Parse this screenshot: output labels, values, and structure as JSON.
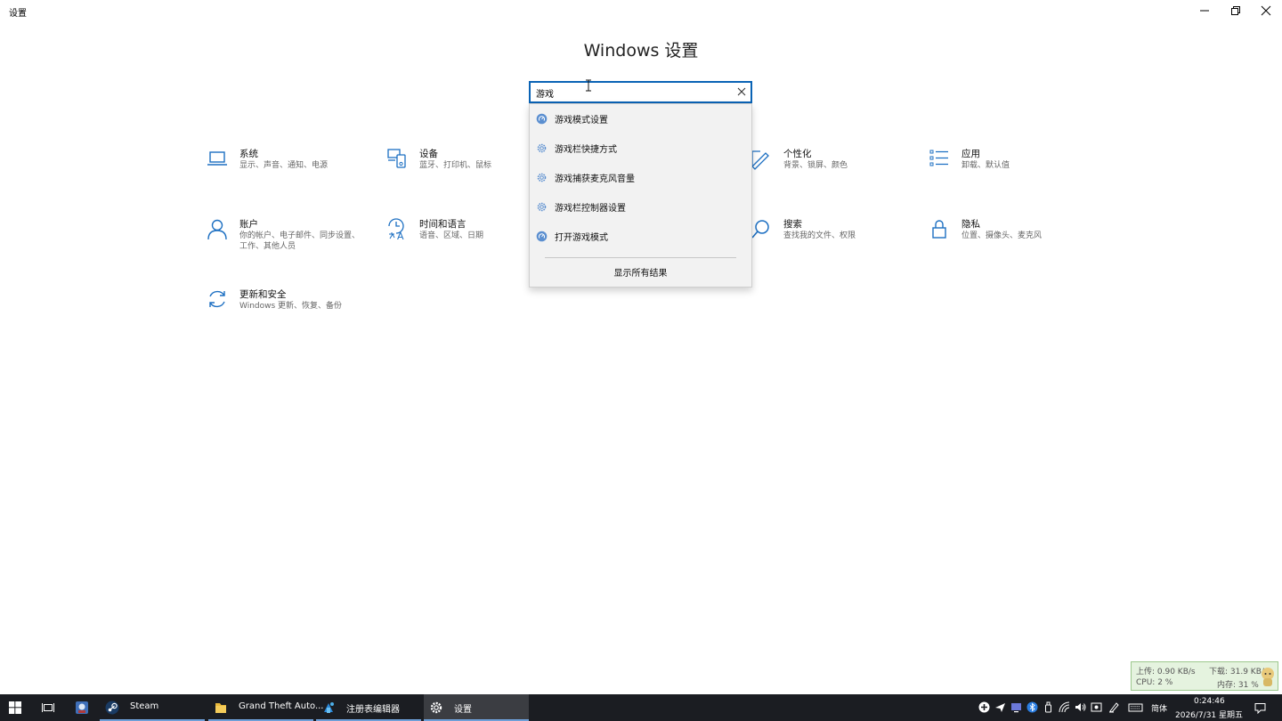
{
  "window": {
    "title": "设置"
  },
  "heading": "Windows 设置",
  "search": {
    "value": "游戏",
    "placeholder": ""
  },
  "suggestions": [
    {
      "label": "游戏模式设置",
      "icon": "game-mode-icon"
    },
    {
      "label": "游戏栏快捷方式",
      "icon": "gear-icon"
    },
    {
      "label": "游戏捕获麦克风音量",
      "icon": "gear-icon"
    },
    {
      "label": "游戏栏控制器设置",
      "icon": "gear-icon"
    },
    {
      "label": "打开游戏模式",
      "icon": "game-mode-icon"
    }
  ],
  "show_all": "显示所有结果",
  "tiles": [
    {
      "title": "系统",
      "desc": "显示、声音、通知、电源",
      "icon": "laptop-icon"
    },
    {
      "title": "设备",
      "desc": "蓝牙、打印机、鼠标",
      "icon": "devices-icon"
    },
    {
      "title": "个性化",
      "desc": "背景、锁屏、颜色",
      "icon": "personalization-icon"
    },
    {
      "title": "应用",
      "desc": "卸载、默认值",
      "icon": "apps-icon"
    },
    {
      "title": "账户",
      "desc": "你的帐户、电子邮件、同步设置、工作、其他人员",
      "icon": "person-icon"
    },
    {
      "title": "时间和语言",
      "desc": "语音、区域、日期",
      "icon": "time-language-icon"
    },
    {
      "title": "搜索",
      "desc": "查找我的文件、权限",
      "icon": "search-icon"
    },
    {
      "title": "隐私",
      "desc": "位置、摄像头、麦克风",
      "icon": "lock-icon"
    },
    {
      "title": "更新和安全",
      "desc": "Windows 更新、恢复、备份",
      "icon": "update-icon"
    }
  ],
  "netwidget": {
    "up": "上传: 0.90 KB/s",
    "down": "下载: 31.9 KB/s",
    "cpu": "CPU: 2 %",
    "mem": "内存: 31 %"
  },
  "taskbar": {
    "apps": [
      {
        "label": "Steam",
        "icon": "steam-icon"
      },
      {
        "label": "Grand Theft Auto...",
        "icon": "folder-icon"
      },
      {
        "label": "注册表编辑器",
        "icon": "registry-icon"
      },
      {
        "label": "设置",
        "icon": "gear-icon"
      }
    ],
    "ime": "简体",
    "time": "0:24:46",
    "date": "2026/7/31 星期五"
  },
  "colors": {
    "accent": "#0a63b5",
    "icon_blue": "#1c6fc2",
    "taskbar": "#1b1d22"
  }
}
